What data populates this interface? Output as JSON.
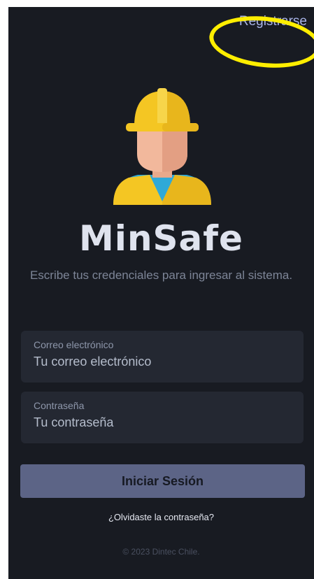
{
  "header": {
    "register_label": "Registrarse"
  },
  "app": {
    "name": "MinSafe",
    "subtitle": "Escribe tus credenciales para ingresar al sistema."
  },
  "form": {
    "email": {
      "label": "Correo electrónico",
      "placeholder": "Tu correo electrónico"
    },
    "password": {
      "label": "Contraseña",
      "placeholder": "Tu contraseña"
    },
    "submit_label": "Iniciar Sesión",
    "forgot_label": "¿Olvidaste la contraseña?"
  },
  "footer": {
    "copyright": "© 2023 Dintec Chile."
  },
  "colors": {
    "background": "#181b22",
    "accent": "#a9b4e8",
    "button": "#5c6486",
    "annotation": "#ffee00"
  }
}
